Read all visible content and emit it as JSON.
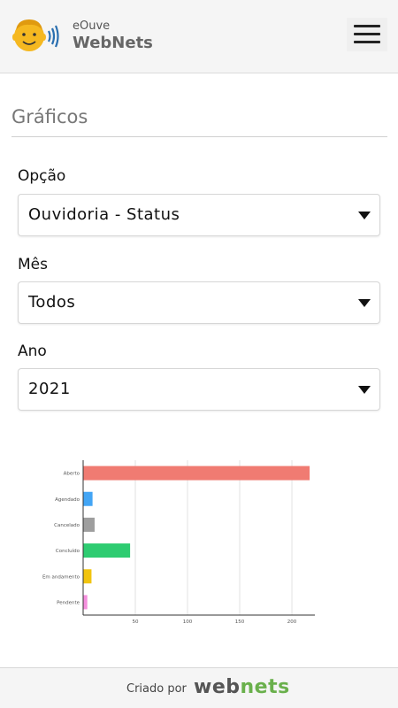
{
  "header": {
    "brand_small": "eOuve",
    "brand_large": "WebNets"
  },
  "page": {
    "title": "Gráficos"
  },
  "form": {
    "opcao": {
      "label": "Opção",
      "value": "Ouvidoria - Status"
    },
    "mes": {
      "label": "Mês",
      "value": "Todos"
    },
    "ano": {
      "label": "Ano",
      "value": "2021"
    }
  },
  "chart_data": {
    "type": "bar",
    "orientation": "horizontal",
    "categories": [
      "Aberto",
      "Agendado",
      "Cancelado",
      "Concluído",
      "Em andamento",
      "Pendente"
    ],
    "values": [
      217,
      9,
      11,
      45,
      8,
      4
    ],
    "colors": [
      "#f07b72",
      "#42a5f5",
      "#9e9e9e",
      "#2ecc71",
      "#f1c40f",
      "#f48fdd"
    ],
    "xticks": [
      50,
      100,
      150,
      200
    ],
    "xlim": [
      0,
      222
    ],
    "grid": true
  },
  "footer": {
    "label": "Criado por",
    "brand_a": "web",
    "brand_b": "nets"
  },
  "colors": {
    "accent_green": "#6ab04c",
    "logo_face": "#f5b820",
    "logo_waves": "#2a6fb0"
  }
}
